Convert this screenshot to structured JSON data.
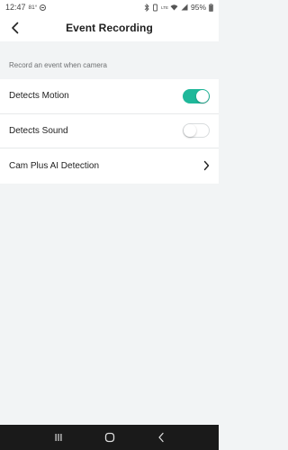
{
  "status_bar": {
    "time": "12:47",
    "temperature": "81°",
    "signal_label": "LTE",
    "battery": "95%"
  },
  "header": {
    "title": "Event Recording",
    "back_icon": "chevron-left-icon"
  },
  "section": {
    "label": "Record an event when camera"
  },
  "settings": [
    {
      "label": "Detects Motion",
      "control": "toggle",
      "state": "on"
    },
    {
      "label": "Detects Sound",
      "control": "toggle",
      "state": "off"
    },
    {
      "label": "Cam Plus AI Detection",
      "control": "chevron"
    }
  ],
  "colors": {
    "accent": "#1fb89a",
    "background": "#f2f4f5",
    "card": "#ffffff",
    "nav_bar": "#1a1a1a"
  },
  "nav_bar": {
    "buttons": [
      "recent-apps-icon",
      "home-icon",
      "back-icon"
    ]
  }
}
